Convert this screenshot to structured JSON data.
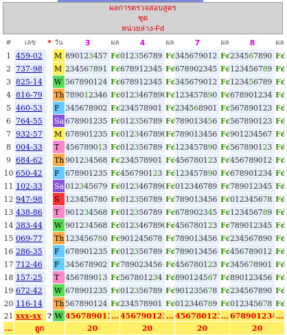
{
  "header": {
    "line1": "ผลการตรวจสอบสูตร",
    "line2": "ชุด",
    "line3": "หน่วยล่าง-Fd"
  },
  "columns": {
    "idx": "#",
    "code": "เลข",
    "star": "*",
    "day": "วัน",
    "c3": "3",
    "res1": "ผล",
    "c4": "4",
    "res2": "ผล",
    "c7": "7",
    "res3": "ผล",
    "c8": "8",
    "res4": "ผล"
  },
  "day_colors": {
    "M": "#ffee55",
    "Tu": "#ff88cc",
    "W": "#55dd55",
    "Th": "#ffaa44",
    "F": "#66ccff",
    "Sa": "#8855dd",
    "Su": "#ff3333"
  },
  "rows": [
    {
      "i": "1",
      "code": "459-02",
      "day": "M",
      "dk": "M",
      "a": [
        "89012",
        "3",
        "457"
      ],
      "b": [
        "012",
        "3",
        "56789"
      ],
      "c": [
        "345679012"
      ],
      "d": [
        "2345",
        "6",
        "7890"
      ]
    },
    {
      "i": "2",
      "code": "737-98",
      "day": "M",
      "dk": "M",
      "a": [
        "23456",
        "7",
        "891"
      ],
      "b": [
        "678912345"
      ],
      "c": [
        "678902345"
      ],
      "d": [
        "1234567",
        "8",
        "9"
      ]
    },
    {
      "i": "3",
      "code": "825-14",
      "day": "W",
      "dk": "W",
      "a": [
        "567890124"
      ],
      "b": [
        "678912345"
      ],
      "c": [
        "345679012"
      ],
      "d": [
        "1234",
        "5",
        "6789"
      ]
    },
    {
      "i": "4",
      "code": "816-79",
      "day": "Th",
      "dk": "Th",
      "a": [
        "7890",
        "1",
        "2346"
      ],
      "b": [
        "012",
        "3",
        "467890"
      ],
      "c": [
        "1234578",
        "9",
        "0"
      ],
      "d": [
        "678901234"
      ]
    },
    {
      "i": "5",
      "code": "460-53",
      "day": "F",
      "dk": "F",
      "a": [
        "345678902"
      ],
      "b": [
        "234578901"
      ],
      "c": [
        "2345",
        "6",
        "8901"
      ],
      "d": [
        "567890123"
      ]
    },
    {
      "i": "6",
      "code": "764-55",
      "day": "Sa",
      "dk": "Sa",
      "a": [
        "678901235"
      ],
      "b": [
        "012",
        "3",
        "56789"
      ],
      "c": [
        "7890134",
        "5",
        "6"
      ],
      "d": [
        "567890123"
      ]
    },
    {
      "i": "7",
      "code": "932-57",
      "day": "M",
      "dk": "M",
      "a": [
        "678901235"
      ],
      "b": [
        "012",
        "3",
        "467890"
      ],
      "c": [
        "789013456"
      ],
      "d": [
        "901234567"
      ]
    },
    {
      "i": "8",
      "code": "004-33",
      "day": "T",
      "dk": "Tu",
      "a": [
        "4567890",
        "1",
        "3"
      ],
      "b": [
        "012",
        "3",
        "56789"
      ],
      "c": [
        "1234578",
        "9",
        "0"
      ],
      "d": [
        "5678901",
        "2",
        "3"
      ]
    },
    {
      "i": "9",
      "code": "684-62",
      "day": "Th",
      "dk": "Th",
      "a": [
        "9012",
        "3",
        "4568"
      ],
      "b": [
        "234578901"
      ],
      "c": [
        "4567801",
        "2",
        "3"
      ],
      "d": [
        "456789012"
      ]
    },
    {
      "i": "10",
      "code": "650-42",
      "day": "F",
      "dk": "F",
      "a": [
        "678901235"
      ],
      "b": [
        "4567901",
        "2",
        "3"
      ],
      "c": [
        "1234578",
        "9",
        "0"
      ],
      "d": [
        "678901234"
      ]
    },
    {
      "i": "11",
      "code": "102-33",
      "day": "Sa",
      "dk": "Sa",
      "a": [
        "012",
        "3",
        "45679"
      ],
      "b": [
        "012",
        "3",
        "467890"
      ],
      "c": [
        "012346789"
      ],
      "d": [
        "789012345"
      ]
    },
    {
      "i": "12",
      "code": "947-98",
      "day": "S",
      "dk": "Su",
      "a": [
        "123456780"
      ],
      "b": [
        "012",
        "3",
        "56789"
      ],
      "c": [
        "789013456"
      ],
      "d": [
        "0123456",
        "7",
        "8"
      ]
    },
    {
      "i": "13",
      "code": "438-86",
      "day": "T",
      "dk": "Tu",
      "a": [
        "9012",
        "3",
        "4568"
      ],
      "b": [
        "012",
        "3",
        "56789"
      ],
      "c": [
        "6789023",
        "4",
        "5"
      ],
      "d": [
        "1234567",
        "8",
        "9"
      ]
    },
    {
      "i": "14",
      "code": "383-44",
      "day": "W",
      "dk": "W",
      "a": [
        "9012",
        "3",
        "4568"
      ],
      "b": [
        "012",
        "3",
        "467890"
      ],
      "c": [
        "4567801",
        "2",
        "3"
      ],
      "d": [
        "789012345"
      ]
    },
    {
      "i": "15",
      "code": "069-77",
      "day": "Th",
      "dk": "Th",
      "a": [
        "1234567",
        "8",
        "0"
      ],
      "b": [
        "901245678"
      ],
      "c": [
        "789013456"
      ],
      "d": [
        "234567890"
      ]
    },
    {
      "i": "16",
      "code": "286-35",
      "day": "F",
      "dk": "F",
      "a": [
        "678901235"
      ],
      "b": [
        "012",
        "3",
        "56789"
      ],
      "c": [
        "789013456"
      ],
      "d": [
        "456789012"
      ]
    },
    {
      "i": "17",
      "code": "712-46",
      "day": "F",
      "dk": "F",
      "a": [
        "345678902"
      ],
      "b": [
        "789023456"
      ],
      "c": [
        "4567801",
        "2",
        "3"
      ],
      "d": [
        "3456",
        "7",
        "8901"
      ]
    },
    {
      "i": "18",
      "code": "157-25",
      "day": "T",
      "dk": "Tu",
      "a": [
        "4567890",
        "1",
        "3"
      ],
      "b": [
        "5678012",
        "3",
        "4"
      ],
      "c": [
        "8901245",
        "6",
        "7"
      ],
      "d": [
        "890123456"
      ]
    },
    {
      "i": "19",
      "code": "672-42",
      "day": "W",
      "dk": "W",
      "a": [
        "678901235"
      ],
      "b": [
        "012",
        "3",
        "56789"
      ],
      "c": [
        "9012356",
        "7",
        "8"
      ],
      "d": [
        "234567890"
      ]
    },
    {
      "i": "20",
      "code": "116-14",
      "day": "Th",
      "dk": "Th",
      "a": [
        "567890124"
      ],
      "b": [
        "234578901"
      ],
      "c": [
        "0123467",
        "8",
        "9"
      ],
      "d": [
        "0123456",
        "7",
        "8"
      ]
    }
  ],
  "total": {
    "i": "21",
    "code": "xxx-xx",
    "q": "?",
    "day": "W",
    "dk": "W",
    "a": "456789013",
    "b": "456790123",
    "c": "456780123",
    "d": "678901234",
    "dots": "..."
  },
  "score": {
    "lead": "...",
    "label": "ถูก",
    "a": "20",
    "b": "20",
    "c": "20",
    "d": "20",
    "dots": "..."
  }
}
